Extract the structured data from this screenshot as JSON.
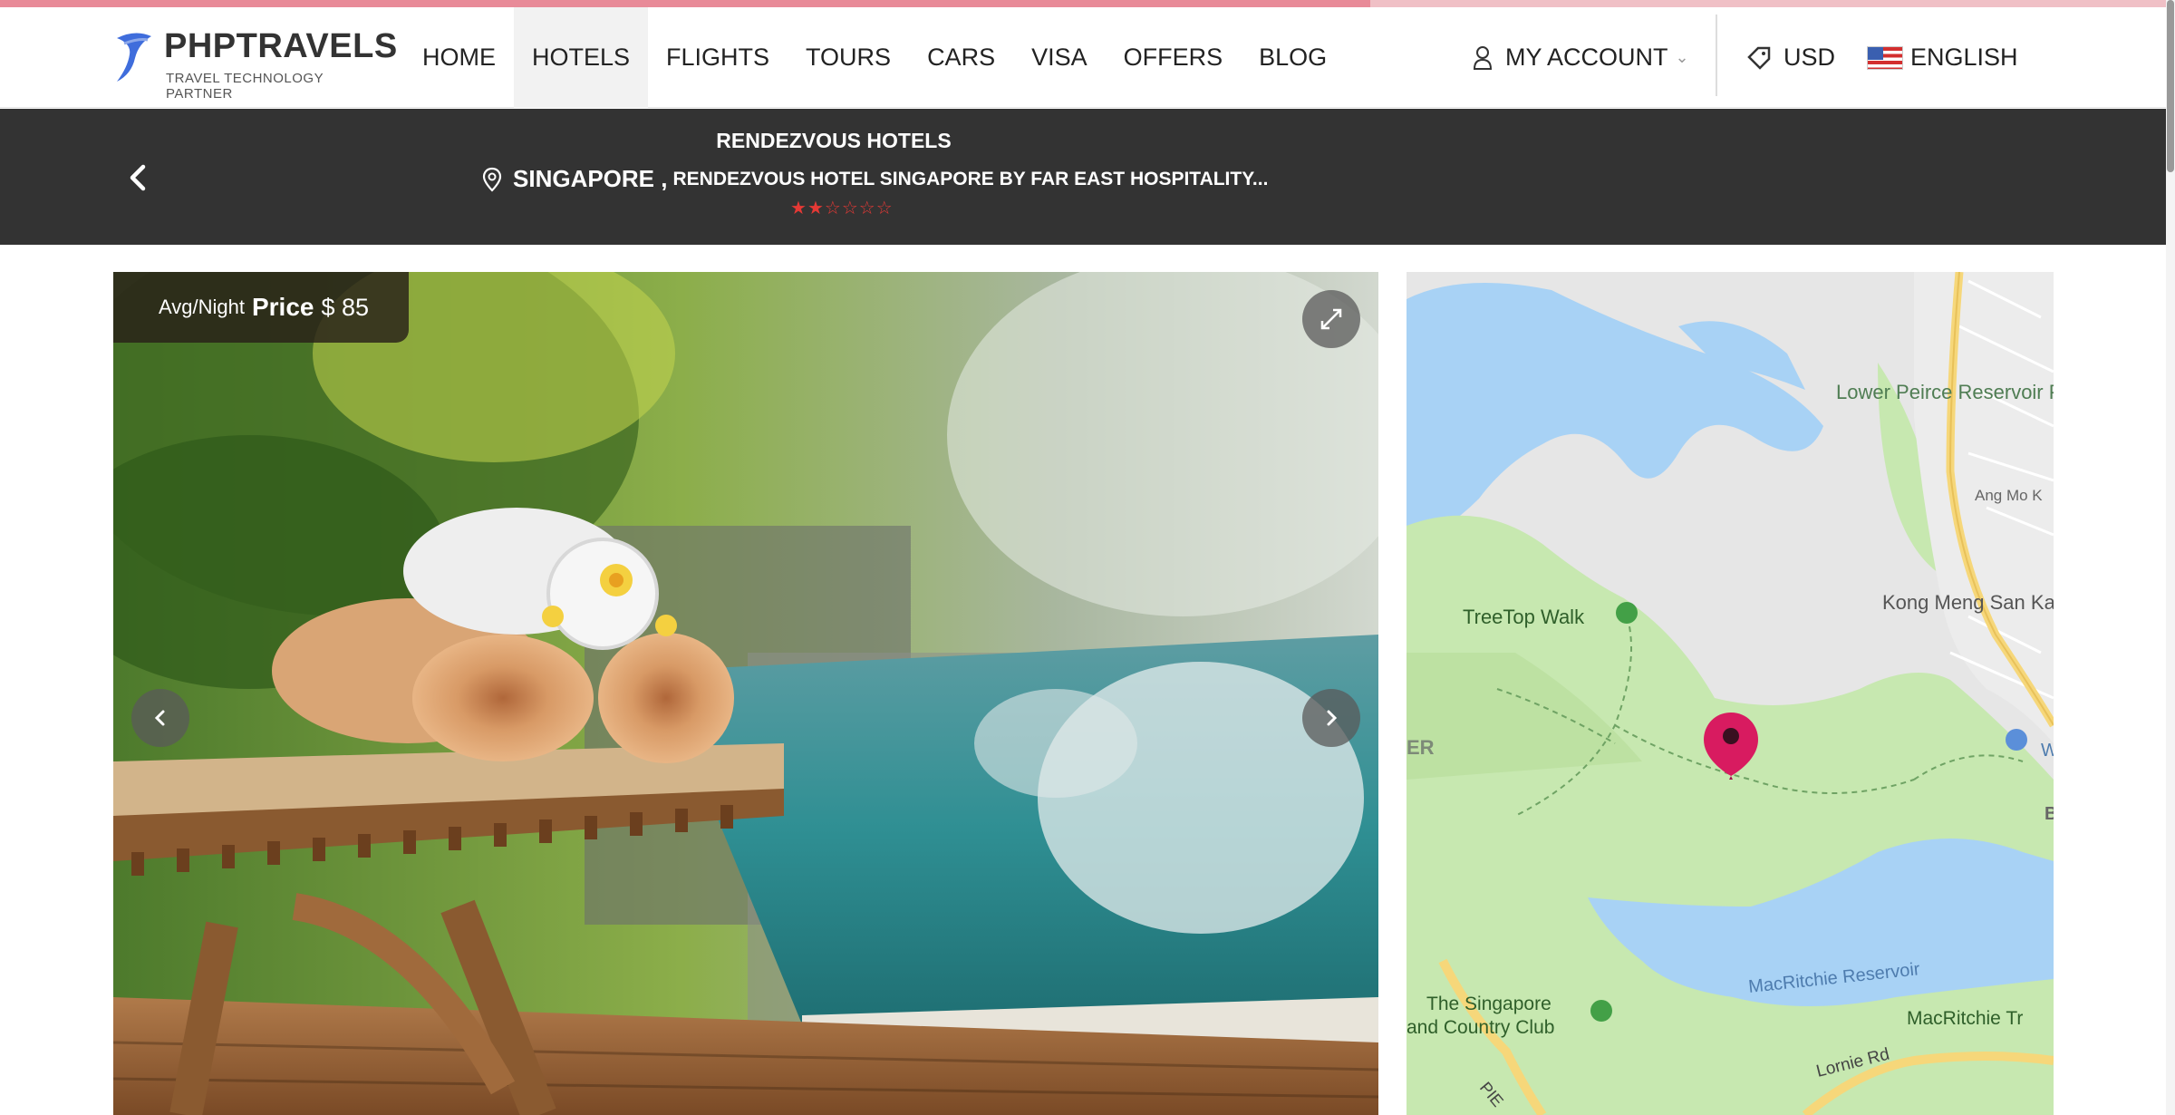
{
  "page": {
    "progress_fraction": 0.63
  },
  "brand": {
    "name": "PHPTRAVELS",
    "tagline": "TRAVEL TECHNOLOGY PARTNER"
  },
  "nav": {
    "items": [
      {
        "label": "HOME"
      },
      {
        "label": "HOTELS",
        "active": true
      },
      {
        "label": "FLIGHTS"
      },
      {
        "label": "TOURS"
      },
      {
        "label": "CARS"
      },
      {
        "label": "VISA"
      },
      {
        "label": "OFFERS"
      },
      {
        "label": "BLOG"
      }
    ],
    "account_label": "MY ACCOUNT",
    "currency_label": "USD",
    "language_label": "ENGLISH"
  },
  "hotel": {
    "title": "RENDEZVOUS HOTELS",
    "city": "SINGAPORE ,",
    "address": "RENDEZVOUS HOTEL SINGAPORE BY FAR EAST HOSPITALITY...",
    "rating": 2,
    "rating_max": 6
  },
  "price": {
    "prefix": "Avg/Night",
    "label": "Price",
    "value": "$ 85"
  },
  "map": {
    "labels": {
      "park": "Lower Peirce Reservoir Park",
      "angmo": "Ang Mo K",
      "treetop": "TreeTop Walk",
      "kongmeng": "Kong Meng San Kark See Mona",
      "er": "ER",
      "macritchie": "MacRitchie Reservoir",
      "macritchie_tr": "MacRitchie Tr",
      "club1": "The Singapore",
      "club2": "and Country Club",
      "lornie": "Lornie Rd",
      "pie": "PIE",
      "w": "W",
      "b": "B"
    }
  },
  "colors": {
    "accent": "#e53935",
    "dark_bar": "#333333",
    "pin": "#d81b60"
  }
}
